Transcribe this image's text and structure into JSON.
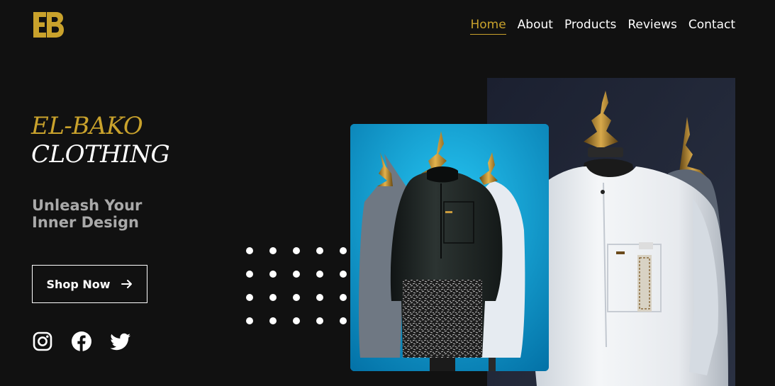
{
  "header": {
    "logo_text": "EB",
    "nav": [
      {
        "label": "Home",
        "active": true
      },
      {
        "label": "About",
        "active": false
      },
      {
        "label": "Products",
        "active": false
      },
      {
        "label": "Reviews",
        "active": false
      },
      {
        "label": "Contact",
        "active": false
      }
    ]
  },
  "hero": {
    "brand_line1": "EL-BAKO",
    "brand_line2": "CLOTHING",
    "tagline_line1": "Unleash Your",
    "tagline_line2": "Inner Design",
    "cta_label": "Shop Now",
    "cta_icon": "arrow-right-icon"
  },
  "social": [
    {
      "icon": "instagram-icon"
    },
    {
      "icon": "facebook-icon"
    },
    {
      "icon": "twitter-icon"
    }
  ],
  "colors": {
    "background": "#111111",
    "accent_gold": "#c9a22c",
    "text_white": "#ffffff",
    "tagline_gray": "#a9a9a9",
    "front_photo_blue": "#0aa3da"
  }
}
